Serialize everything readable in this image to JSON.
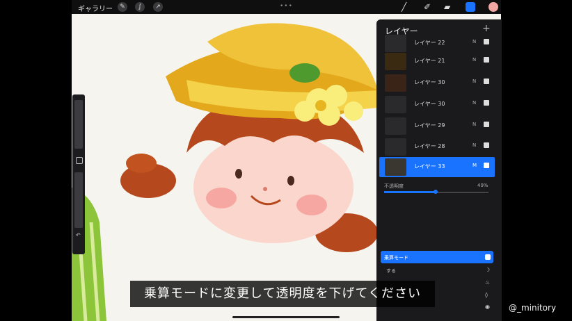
{
  "toolbar": {
    "gallery_label": "ギャラリー",
    "grip": "•••"
  },
  "canvas": {
    "illustration": "girl-with-straw-hat"
  },
  "layers_panel": {
    "title": "レイヤー",
    "add_label": "+",
    "layers": [
      {
        "name": "レイヤー 22",
        "mode": "N",
        "selected": false
      },
      {
        "name": "レイヤー 21",
        "mode": "N",
        "selected": false
      },
      {
        "name": "レイヤー 30",
        "mode": "N",
        "selected": false
      },
      {
        "name": "レイヤー 30",
        "mode": "N",
        "selected": false
      },
      {
        "name": "レイヤー 29",
        "mode": "N",
        "selected": false
      },
      {
        "name": "レイヤー 28",
        "mode": "N",
        "selected": false
      },
      {
        "name": "レイヤー 33",
        "mode": "M",
        "selected": true
      }
    ],
    "opacity_label": "不透明度",
    "opacity_value": "49%",
    "opacity": 0.49,
    "blend_mode_label": "乗算モード",
    "blend_options": [
      {
        "label": "する",
        "icon": "moon-icon"
      },
      {
        "label": "",
        "icon": "flame-icon"
      },
      {
        "label": "",
        "icon": "drop-icon"
      },
      {
        "label": "",
        "icon": "circle-icon"
      }
    ]
  },
  "caption": "乗算モードに変更して透明度を下げてください",
  "watermark": "@_minitory",
  "colors": {
    "accent": "#1a73ff",
    "current_color": "#f2a7a2"
  }
}
